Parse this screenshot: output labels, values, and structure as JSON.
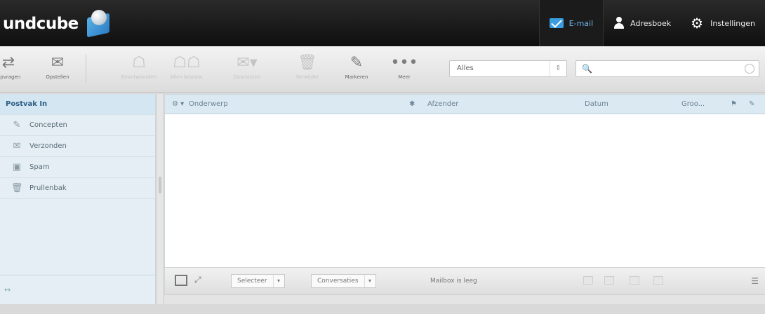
{
  "app": {
    "logo_text": "undcube"
  },
  "topnav": {
    "mail": "E-mail",
    "addressbook": "Adresboek",
    "settings": "Instellingen"
  },
  "toolbar": {
    "items": [
      {
        "label": "Opvragen",
        "icon": "refresh-icon"
      },
      {
        "label": "Opstellen",
        "icon": "compose-icon"
      },
      {
        "label": "Beantwoorden",
        "icon": "reply-icon"
      },
      {
        "label": "Allen beantw.",
        "icon": "reply-all-icon"
      },
      {
        "label": "Doorsturen",
        "icon": "forward-icon"
      },
      {
        "label": "Verwijder",
        "icon": "delete-icon"
      },
      {
        "label": "Markeren",
        "icon": "mark-icon"
      },
      {
        "label": "Meer",
        "icon": "more-icon"
      }
    ],
    "filter_value": "Alles",
    "search_placeholder": ""
  },
  "folders": [
    {
      "label": "Postvak In",
      "icon": "inbox-icon",
      "selected": true
    },
    {
      "label": "Concepten",
      "icon": "drafts-icon"
    },
    {
      "label": "Verzonden",
      "icon": "sent-icon"
    },
    {
      "label": "Spam",
      "icon": "spam-icon"
    },
    {
      "label": "Prullenbak",
      "icon": "trash-icon"
    }
  ],
  "list": {
    "columns": {
      "subject": "Onderwerp",
      "from": "Afzender",
      "date": "Datum",
      "size": "Groo..."
    },
    "select_label": "Selecteer",
    "threads_label": "Conversaties",
    "status": "Mailbox is leeg"
  }
}
